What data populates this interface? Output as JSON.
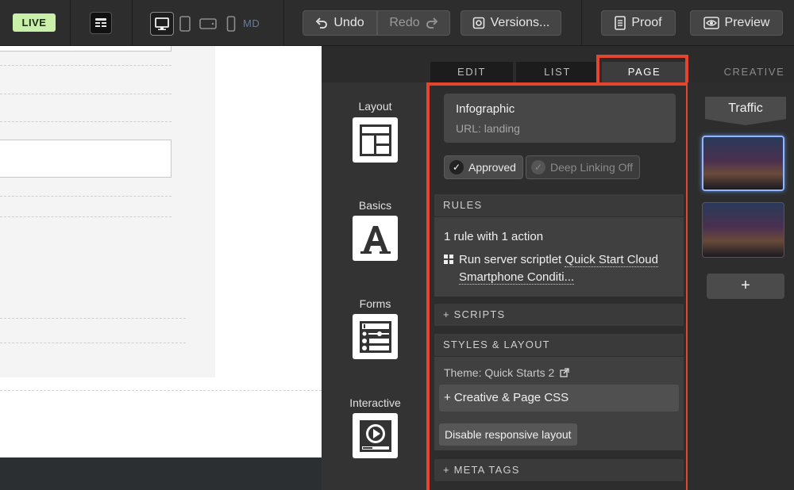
{
  "toolbar": {
    "live_label": "LIVE",
    "device_size_label": "MD",
    "undo_label": "Undo",
    "redo_label": "Redo",
    "versions_label": "Versions...",
    "proof_label": "Proof",
    "preview_label": "Preview"
  },
  "tabs": {
    "edit": "EDIT",
    "list": "LIST",
    "page": "PAGE",
    "creative": "CREATIVE"
  },
  "widgets": [
    {
      "label": "Layout",
      "icon": "layout-icon"
    },
    {
      "label": "Basics",
      "icon": "text-a-icon"
    },
    {
      "label": "Forms",
      "icon": "form-icon"
    },
    {
      "label": "Interactive",
      "icon": "video-play-icon"
    }
  ],
  "page": {
    "title": "Infographic",
    "url": "URL: landing",
    "approved_label": "Approved",
    "deep_linking_label": "Deep Linking Off",
    "rules": {
      "header": "RULES",
      "summary": "1 rule with 1 action",
      "action_prefix": "Run server scriptlet ",
      "action_link_1": "Quick Start Cloud",
      "action_link_2": "Smartphone Conditi..."
    },
    "scripts_header": "+ SCRIPTS",
    "styles": {
      "header": "STYLES & LAYOUT",
      "theme": "Theme: Quick Starts 2",
      "css_label": "+ Creative & Page CSS",
      "disable_responsive_label": "Disable responsive layout"
    },
    "meta_tags_header": "+ META TAGS"
  },
  "creative": {
    "traffic_label": "Traffic",
    "add_label": "+"
  },
  "colors": {
    "highlight": "#e5452f",
    "live_badge": "#c9f0a8",
    "selected_thumb": "#8fb6ff"
  }
}
